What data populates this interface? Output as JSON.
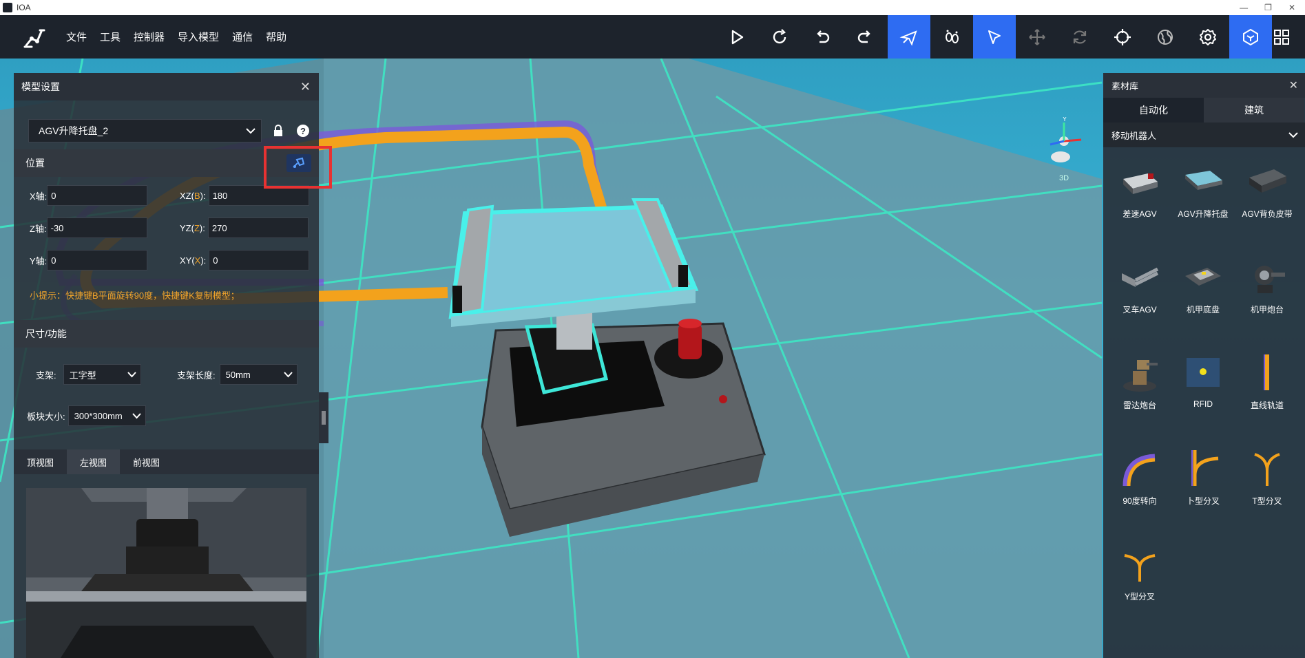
{
  "window": {
    "title": "IOA",
    "minimize": "—",
    "restore": "❐",
    "close": "✕"
  },
  "menu": {
    "items": [
      "文件",
      "工具",
      "控制器",
      "导入模型",
      "通信",
      "帮助"
    ]
  },
  "toolbar": {
    "icons": [
      "play-icon",
      "refresh-icon",
      "undo-icon",
      "redo-icon",
      "fly-icon",
      "walk-icon",
      "select-icon",
      "move-icon",
      "rotate-icon",
      "focus-icon",
      "globe-icon",
      "gear-icon",
      "cube-icon",
      "grid-icon"
    ],
    "active": [
      "fly-icon",
      "select-icon",
      "cube-icon"
    ],
    "accent": "#2e6cf2"
  },
  "gizmo": {
    "label": "3D",
    "y_label": "Y"
  },
  "model_panel": {
    "title": "模型设置",
    "model_name": "AGV升降托盘_2",
    "position": {
      "section": "位置",
      "x_label": "X轴:",
      "x_value": "0",
      "z_label": "Z轴:",
      "z_value": "-30",
      "y_label": "Y轴:",
      "y_value": "0",
      "xz_label": "XZ(",
      "xz_accent": "B",
      "xz_suffix": "):",
      "xz_value": "180",
      "yz_label": "YZ(",
      "yz_accent": "Z",
      "yz_suffix": "):",
      "yz_value": "270",
      "xy_label": "XY(",
      "xy_accent": "X",
      "xy_suffix": "):",
      "xy_value": "0"
    },
    "hint": "小提示：快捷键B平面旋转90度，快捷键K复制模型；",
    "size": {
      "section": "尺寸/功能",
      "stand_label": "支架:",
      "stand_value": "工字型",
      "stand_len_label": "支架长度:",
      "stand_len_value": "50mm",
      "plate_label": "板块大小:",
      "plate_value": "300*300mm"
    },
    "views": [
      "顶视图",
      "左视图",
      "前视图"
    ],
    "active_view": "左视图"
  },
  "library": {
    "title": "素材库",
    "tabs": [
      "自动化",
      "建筑"
    ],
    "active_tab": "自动化",
    "category": "移动机器人",
    "assets": [
      "差速AGV",
      "AGV升降托盘",
      "AGV背负皮带",
      "叉车AGV",
      "机甲底盘",
      "机甲炮台",
      "雷达炮台",
      "RFID",
      "直线轨道",
      "90度转向",
      "卜型分叉",
      "T型分叉",
      "Y型分叉"
    ]
  },
  "colors": {
    "track_orange": "#f3a21c",
    "track_purple": "#7a5ad8",
    "grid_line": "#3ee7c4",
    "highlight_red": "#e83232"
  }
}
